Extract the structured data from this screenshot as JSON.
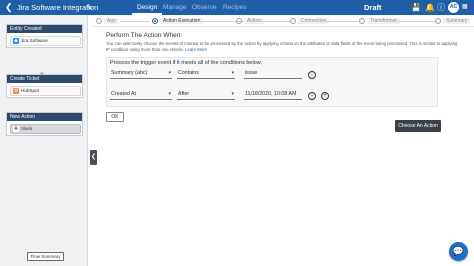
{
  "header": {
    "back_icon": "chevron-left-icon",
    "title": "Jira Software Integration",
    "tabs": [
      "Design",
      "Manage",
      "Observe",
      "Recipes"
    ],
    "active_tab": "Design",
    "status": "Draft",
    "avatar_initials": "AC"
  },
  "colors": {
    "header_bg": "#1f5fa8",
    "card_head_bg": "#2c4a6e",
    "accent": "#1f5fa8",
    "button_dark": "#3a4048"
  },
  "sidebar": {
    "cards": [
      {
        "heading": "Entity Created",
        "item": "Jira Software",
        "icon": "jira-icon",
        "selected": false
      },
      {
        "heading": "Create Ticket",
        "item": "HubSpot",
        "icon": "hubspot-icon",
        "selected": false
      },
      {
        "heading": "New Action",
        "item": "Slack",
        "icon": "slack-icon",
        "selected": true
      }
    ],
    "flow_summary_label": "Flow Summary"
  },
  "stepper": {
    "steps": [
      "App",
      "Action Execution",
      "Action",
      "Connection",
      "Transformer",
      "Summary"
    ],
    "active_step": "Action Execution"
  },
  "main": {
    "section_title": "Perform The Action When:",
    "description": "You can selectively choose the events of interest to be processed by the action by applying criteria on the attributes or data fields of the event being processed. This is similar to applying IF condition using more than one criteria.",
    "learn_more": "Learn More",
    "conditions_title": "Process the trigger event if it meets all of the conditions below:",
    "conditions": [
      {
        "field": "Summary (abc)",
        "operator": "Contains",
        "value": "issue",
        "actions": [
          "minus"
        ]
      },
      {
        "field": "Created At",
        "operator": "After",
        "value": "11/18/2020, 10:08 AM",
        "actions": [
          "minus",
          "plus"
        ]
      }
    ],
    "ok_label": "OK",
    "choose_action_label": "Choose An Action"
  }
}
